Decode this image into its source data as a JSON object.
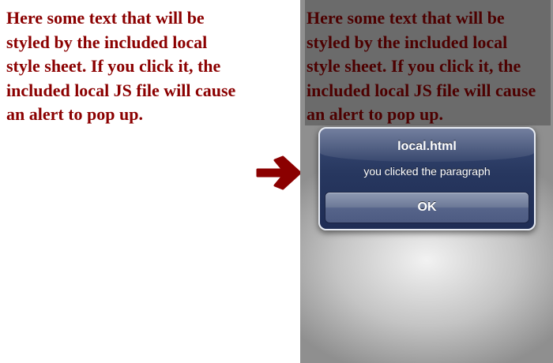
{
  "before": {
    "paragraph": "Here some text that will be styled by the included local style sheet. If you click it, the included local JS file will cause an alert to pop up."
  },
  "after": {
    "paragraph": "Here some text that will be styled by the included local style sheet. If you click it, the included local JS file will cause an alert to pop up.",
    "alert": {
      "title": "local.html",
      "message": "you clicked the paragraph",
      "ok_label": "OK"
    }
  },
  "colors": {
    "paragraph_text": "#8b0000",
    "arrow": "#8b0000",
    "alert_background": "#27375f"
  },
  "icons": {
    "arrow": "right-arrow-icon"
  }
}
